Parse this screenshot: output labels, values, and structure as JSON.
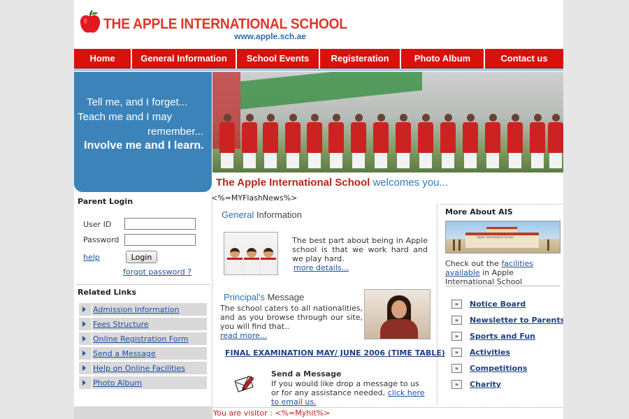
{
  "header": {
    "title": "THE APPLE INTERNATIONAL SCHOOL",
    "url": "www.apple.sch.ae"
  },
  "nav": {
    "items": [
      {
        "label": "Home"
      },
      {
        "label": "General Information"
      },
      {
        "label": "School Events"
      },
      {
        "label": "Registeration"
      },
      {
        "label": "Photo Album"
      },
      {
        "label": "Contact us"
      }
    ]
  },
  "quote": {
    "line1": "Tell me, and I forget...",
    "line2": "Teach me and I may",
    "line3": "remember...",
    "line4": "Involve me and I learn."
  },
  "welcome": {
    "school": "The Apple International School",
    "rest": " welcomes you..."
  },
  "flash_news": "<%=MYFlashNews%>",
  "login": {
    "title": "Parent Login",
    "user_label": "User ID",
    "password_label": "Password",
    "button": "Login",
    "help": "help",
    "forgot": "forgot password ?"
  },
  "related": {
    "title": "Related Links",
    "items": [
      {
        "label": "Admission Information"
      },
      {
        "label": "Fees Structure"
      },
      {
        "label": "Online Registration Form"
      },
      {
        "label": "Send a Message"
      },
      {
        "label": "Help on Online Facilities"
      },
      {
        "label": "Photo Album"
      }
    ]
  },
  "general": {
    "title_blue": "General",
    "title_rest": " Information",
    "text": "The best part about being in Apple school is that we work hard and we play hard.",
    "more": "more details..."
  },
  "principal": {
    "title_blue": "Principal's",
    "title_rest": " Message",
    "text": "The school caters to all nationalities, and as you browse through our site, you will find that..",
    "more": "read more..."
  },
  "exam_link": "FINAL EXAMINATION MAY/ JUNE 2006 (TIME TABLE)",
  "message": {
    "title": "Send a Message",
    "text": "If you would like drop a message to us or for any assistance needed, ",
    "link": "click here to email us."
  },
  "visitor": "You are visitor : <%=Myhit%>",
  "right": {
    "title": "More About AIS",
    "photo_caption": "Apple International School",
    "facilities_pre": "Check out the ",
    "facilities_link": "facilities available",
    "facilities_post": " in Apple International School",
    "links": [
      {
        "label": "Notice Board"
      },
      {
        "label": "Newsletter to Parents"
      },
      {
        "label": "Sports and Fun"
      },
      {
        "label": "Activities"
      },
      {
        "label": "Competitions"
      },
      {
        "label": "Charity"
      }
    ],
    "link_icon": "»"
  },
  "colors": {
    "nav_red": "#d9110d",
    "title_red": "#e0362b",
    "quote_blue": "#3b83b9",
    "link_blue": "#1f4fa0"
  }
}
